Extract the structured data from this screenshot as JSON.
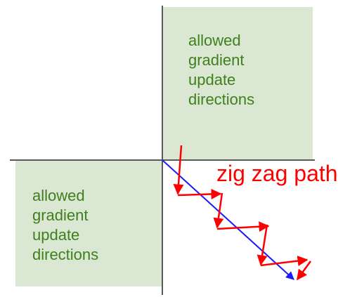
{
  "upper_right_region": {
    "label": "allowed\ngradient\nupdate\ndirections"
  },
  "lower_left_region": {
    "label": "allowed\ngradient\nupdate\ndirections"
  },
  "path_label": "zig zag path",
  "colors": {
    "region_fill": "#dae8d3",
    "region_text": "#3f7f1c",
    "axis": "#595959",
    "zigzag": "#ff0000",
    "direct_path": "#1a1aff"
  }
}
